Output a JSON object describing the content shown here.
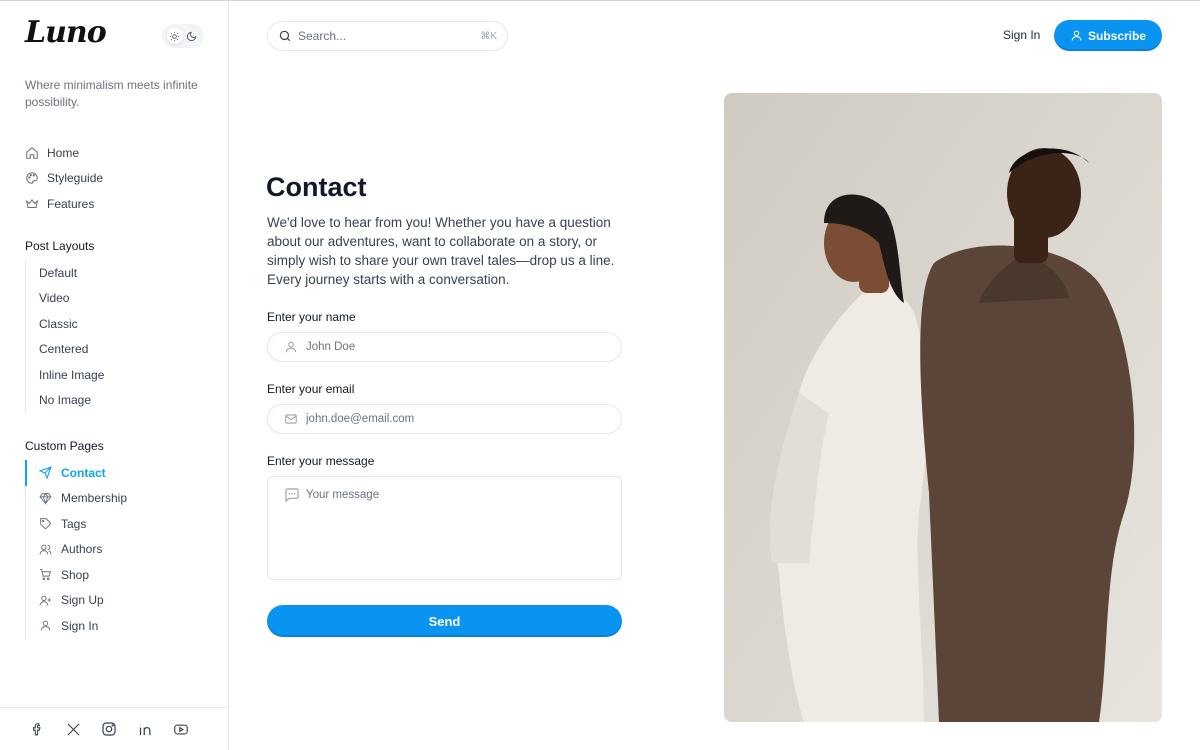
{
  "brand": {
    "logo_text": "Luno",
    "tagline": "Where minimalism meets infinite possibility."
  },
  "theme_toggle": {
    "options": [
      "sun-icon",
      "moon-icon"
    ],
    "active": "light"
  },
  "nav": {
    "main": [
      {
        "label": "Home",
        "icon": "home-icon"
      },
      {
        "label": "Styleguide",
        "icon": "palette-icon"
      },
      {
        "label": "Features",
        "icon": "crown-icon"
      }
    ],
    "post_layouts": {
      "title": "Post Layouts",
      "items": [
        "Default",
        "Video",
        "Classic",
        "Centered",
        "Inline Image",
        "No Image"
      ]
    },
    "custom_pages": {
      "title": "Custom Pages",
      "items": [
        {
          "label": "Contact",
          "icon": "send-icon",
          "active": true
        },
        {
          "label": "Membership",
          "icon": "diamond-icon"
        },
        {
          "label": "Tags",
          "icon": "tag-icon"
        },
        {
          "label": "Authors",
          "icon": "users-icon"
        },
        {
          "label": "Shop",
          "icon": "cart-icon"
        },
        {
          "label": "Sign Up",
          "icon": "user-plus-icon"
        },
        {
          "label": "Sign In",
          "icon": "user-icon"
        }
      ]
    }
  },
  "social": [
    "facebook-icon",
    "x-icon",
    "instagram-icon",
    "linkedin-icon",
    "youtube-icon"
  ],
  "header": {
    "search_placeholder": "Search...",
    "search_shortcut": "⌘K",
    "signin_label": "Sign In",
    "subscribe_label": "Subscribe"
  },
  "contact": {
    "title": "Contact",
    "intro": "We'd love to hear from you! Whether you have a question about our adventures, want to collaborate on a story, or simply wish to share your own travel tales—drop us a line. Every journey starts with a conversation.",
    "name_label": "Enter your name",
    "name_placeholder": "John Doe",
    "email_label": "Enter your email",
    "email_placeholder": "john.doe@email.com",
    "message_label": "Enter your message",
    "message_placeholder": "Your message",
    "send_label": "Send"
  },
  "colors": {
    "accent": "#0a94f2",
    "active_nav": "#0ea5e9",
    "photo_background": "#dedbd5"
  }
}
